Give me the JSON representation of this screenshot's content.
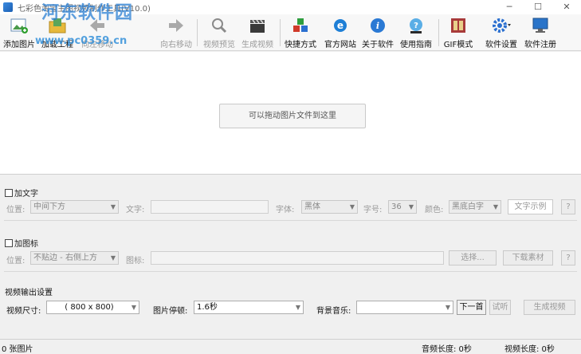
{
  "window": {
    "title": "七彩色淘宝主图视频制作工具(V10.0)",
    "watermark": "河东软件园",
    "watermark_url": "www.pc0359.cn",
    "controls": [
      "─",
      "☐",
      "✕"
    ]
  },
  "toolbar": {
    "add_image": "添加图片",
    "load_project": "加载工程",
    "move_left": "向左移动",
    "move_right": "向右移动",
    "preview_video": "视频预览",
    "generate_video": "生成视频",
    "shortcut": "快捷方式",
    "website": "官方网站",
    "about": "关于软件",
    "guide": "使用指南",
    "gif_mode": "GIF模式",
    "settings": "软件设置",
    "register": "软件注册"
  },
  "dropzone": {
    "hint": "可以拖动图片文件到这里"
  },
  "text_section": {
    "checkbox_label": "加文字",
    "position_label": "位置:",
    "position_value": "中间下方",
    "text_label": "文字:",
    "font_label": "字体:",
    "font_value": "黑体",
    "size_label": "字号:",
    "size_value": "36",
    "color_label": "颜色:",
    "color_value": "黑底白字",
    "example_button": "文字示例",
    "help_button": "?"
  },
  "icon_section": {
    "checkbox_label": "加图标",
    "position_label": "位置:",
    "position_value": "不贴边 - 右侧上方",
    "icon_label": "图标:",
    "choose_button": "选择...",
    "download_button": "下载素材",
    "help_button": "?"
  },
  "output_section": {
    "title": "视频输出设置",
    "size_label": "视频尺寸:",
    "size_value": "( 800 x 800)",
    "pause_label": "图片停顿:",
    "pause_value": "1.6秒",
    "music_label": "背景音乐:",
    "music_value": "",
    "next_button": "下一首",
    "listen_button": "试听",
    "generate_button": "生成视频"
  },
  "status": {
    "image_count": "0 张图片",
    "audio_length": "音频长度: 0秒",
    "video_length": "视频长度: 0秒"
  },
  "colors": {
    "accent_blue": "#2a7fd4",
    "toolbar_bg": "#f7f7f7"
  }
}
